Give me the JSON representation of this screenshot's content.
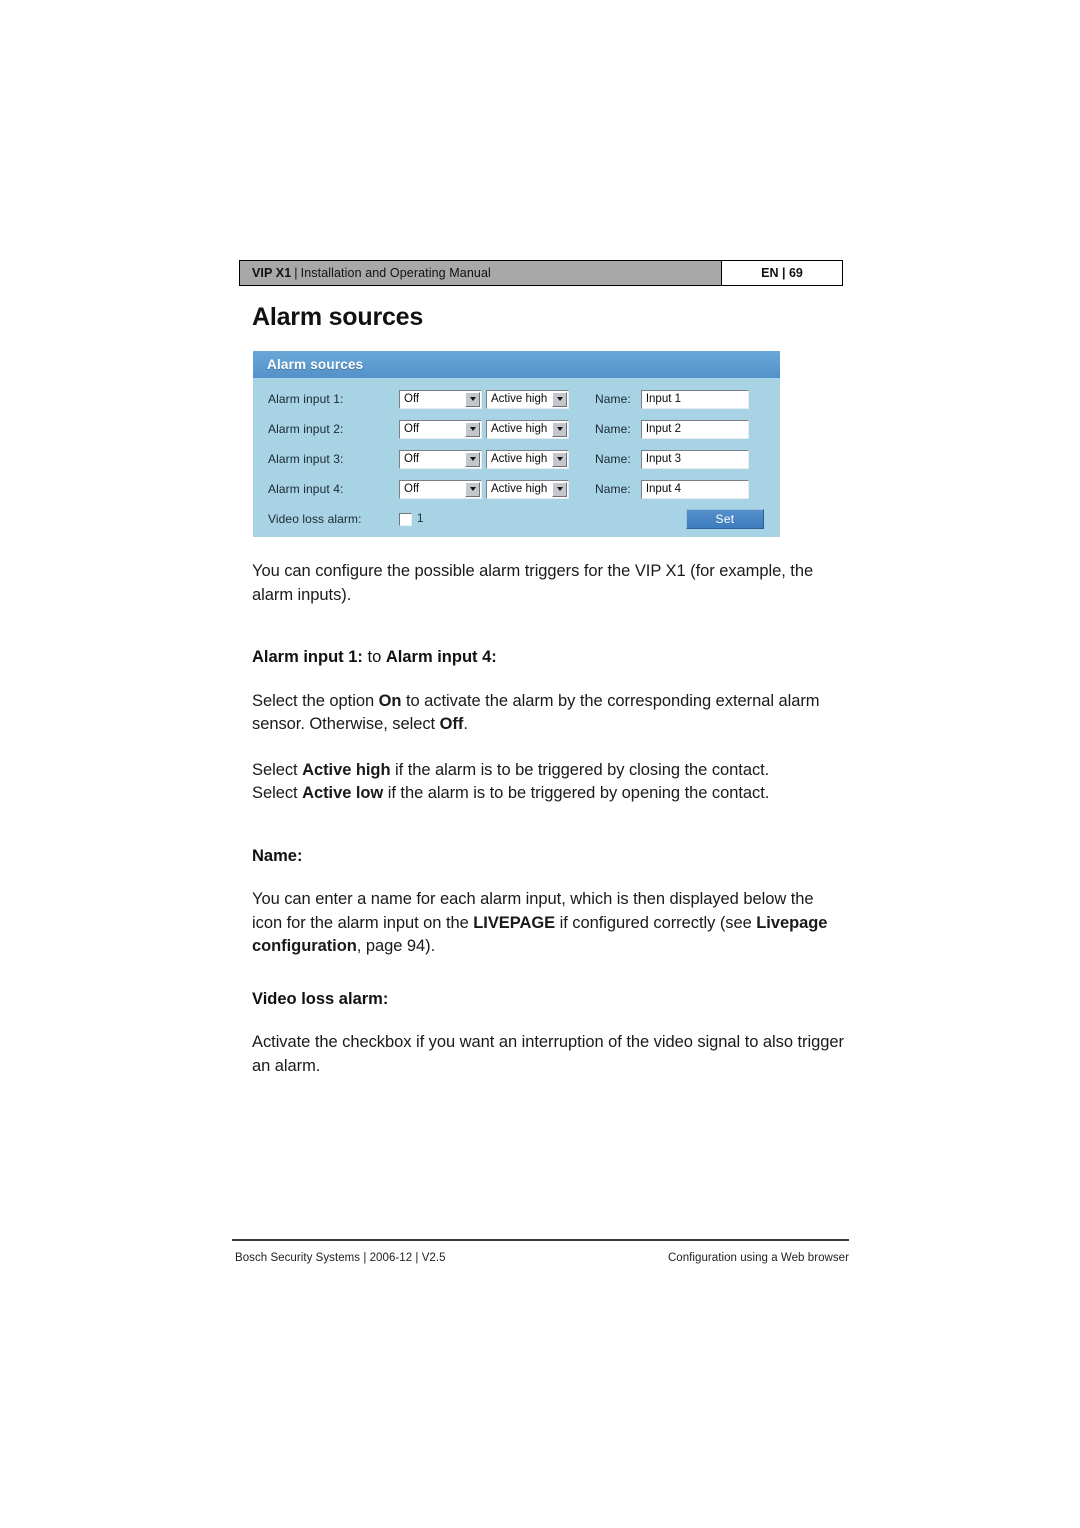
{
  "header": {
    "product": "VIP X1",
    "separator": "|",
    "manual_title": "Installation and Operating Manual",
    "language_page": "EN | 69"
  },
  "page_title": "Alarm sources",
  "ui_panel": {
    "title": "Alarm sources",
    "colors": {
      "header_bar": "#5b9bd0",
      "body": "#a8d3e4",
      "button": "#3f7fbf"
    },
    "rows": [
      {
        "label": "Alarm input 1:",
        "mode_value": "Off",
        "polarity_value": "Active high",
        "name_label": "Name:",
        "name_value": "Input 1"
      },
      {
        "label": "Alarm input 2:",
        "mode_value": "Off",
        "polarity_value": "Active high",
        "name_label": "Name:",
        "name_value": "Input 2"
      },
      {
        "label": "Alarm input 3:",
        "mode_value": "Off",
        "polarity_value": "Active high",
        "name_label": "Name:",
        "name_value": "Input 3"
      },
      {
        "label": "Alarm input 4:",
        "mode_value": "Off",
        "polarity_value": "Active high",
        "name_label": "Name:",
        "name_value": "Input 4"
      }
    ],
    "video_loss": {
      "label": "Video loss alarm:",
      "checkbox_number": "1",
      "checked": false
    },
    "set_button": "Set"
  },
  "content": {
    "intro": "You can configure the possible alarm triggers for the VIP X1 (for example, the alarm inputs).",
    "section_alarm_inputs": {
      "heading_bold_1": "Alarm input 1:",
      "heading_regular": " to ",
      "heading_bold_2": "Alarm input 4:",
      "para1_a": "Select the option ",
      "para1_b": "On",
      "para1_c": " to activate the alarm by the corresponding external alarm sensor. Otherwise, select ",
      "para1_d": "Off",
      "para1_e": ".",
      "para2_a": "Select ",
      "para2_b": "Active high",
      "para2_c": " if the alarm is to be triggered by closing the contact.",
      "para3_a": "Select ",
      "para3_b": "Active low",
      "para3_c": " if the alarm is to be triggered by opening the contact."
    },
    "section_name": {
      "heading": "Name:",
      "para_a": "You can enter a name for each alarm input, which is then displayed below the icon for the alarm input on the ",
      "para_b": "LIVEPAGE",
      "para_c": " if configured correctly (see ",
      "para_d": "Livepage configuration",
      "para_e": ", page 94)."
    },
    "section_video_loss": {
      "heading": "Video loss alarm:",
      "para": "Activate the checkbox if you want an interruption of the video signal to also trigger an alarm."
    }
  },
  "footer": {
    "left": "Bosch Security Systems | 2006-12 | V2.5",
    "right": "Configuration using a Web browser"
  }
}
